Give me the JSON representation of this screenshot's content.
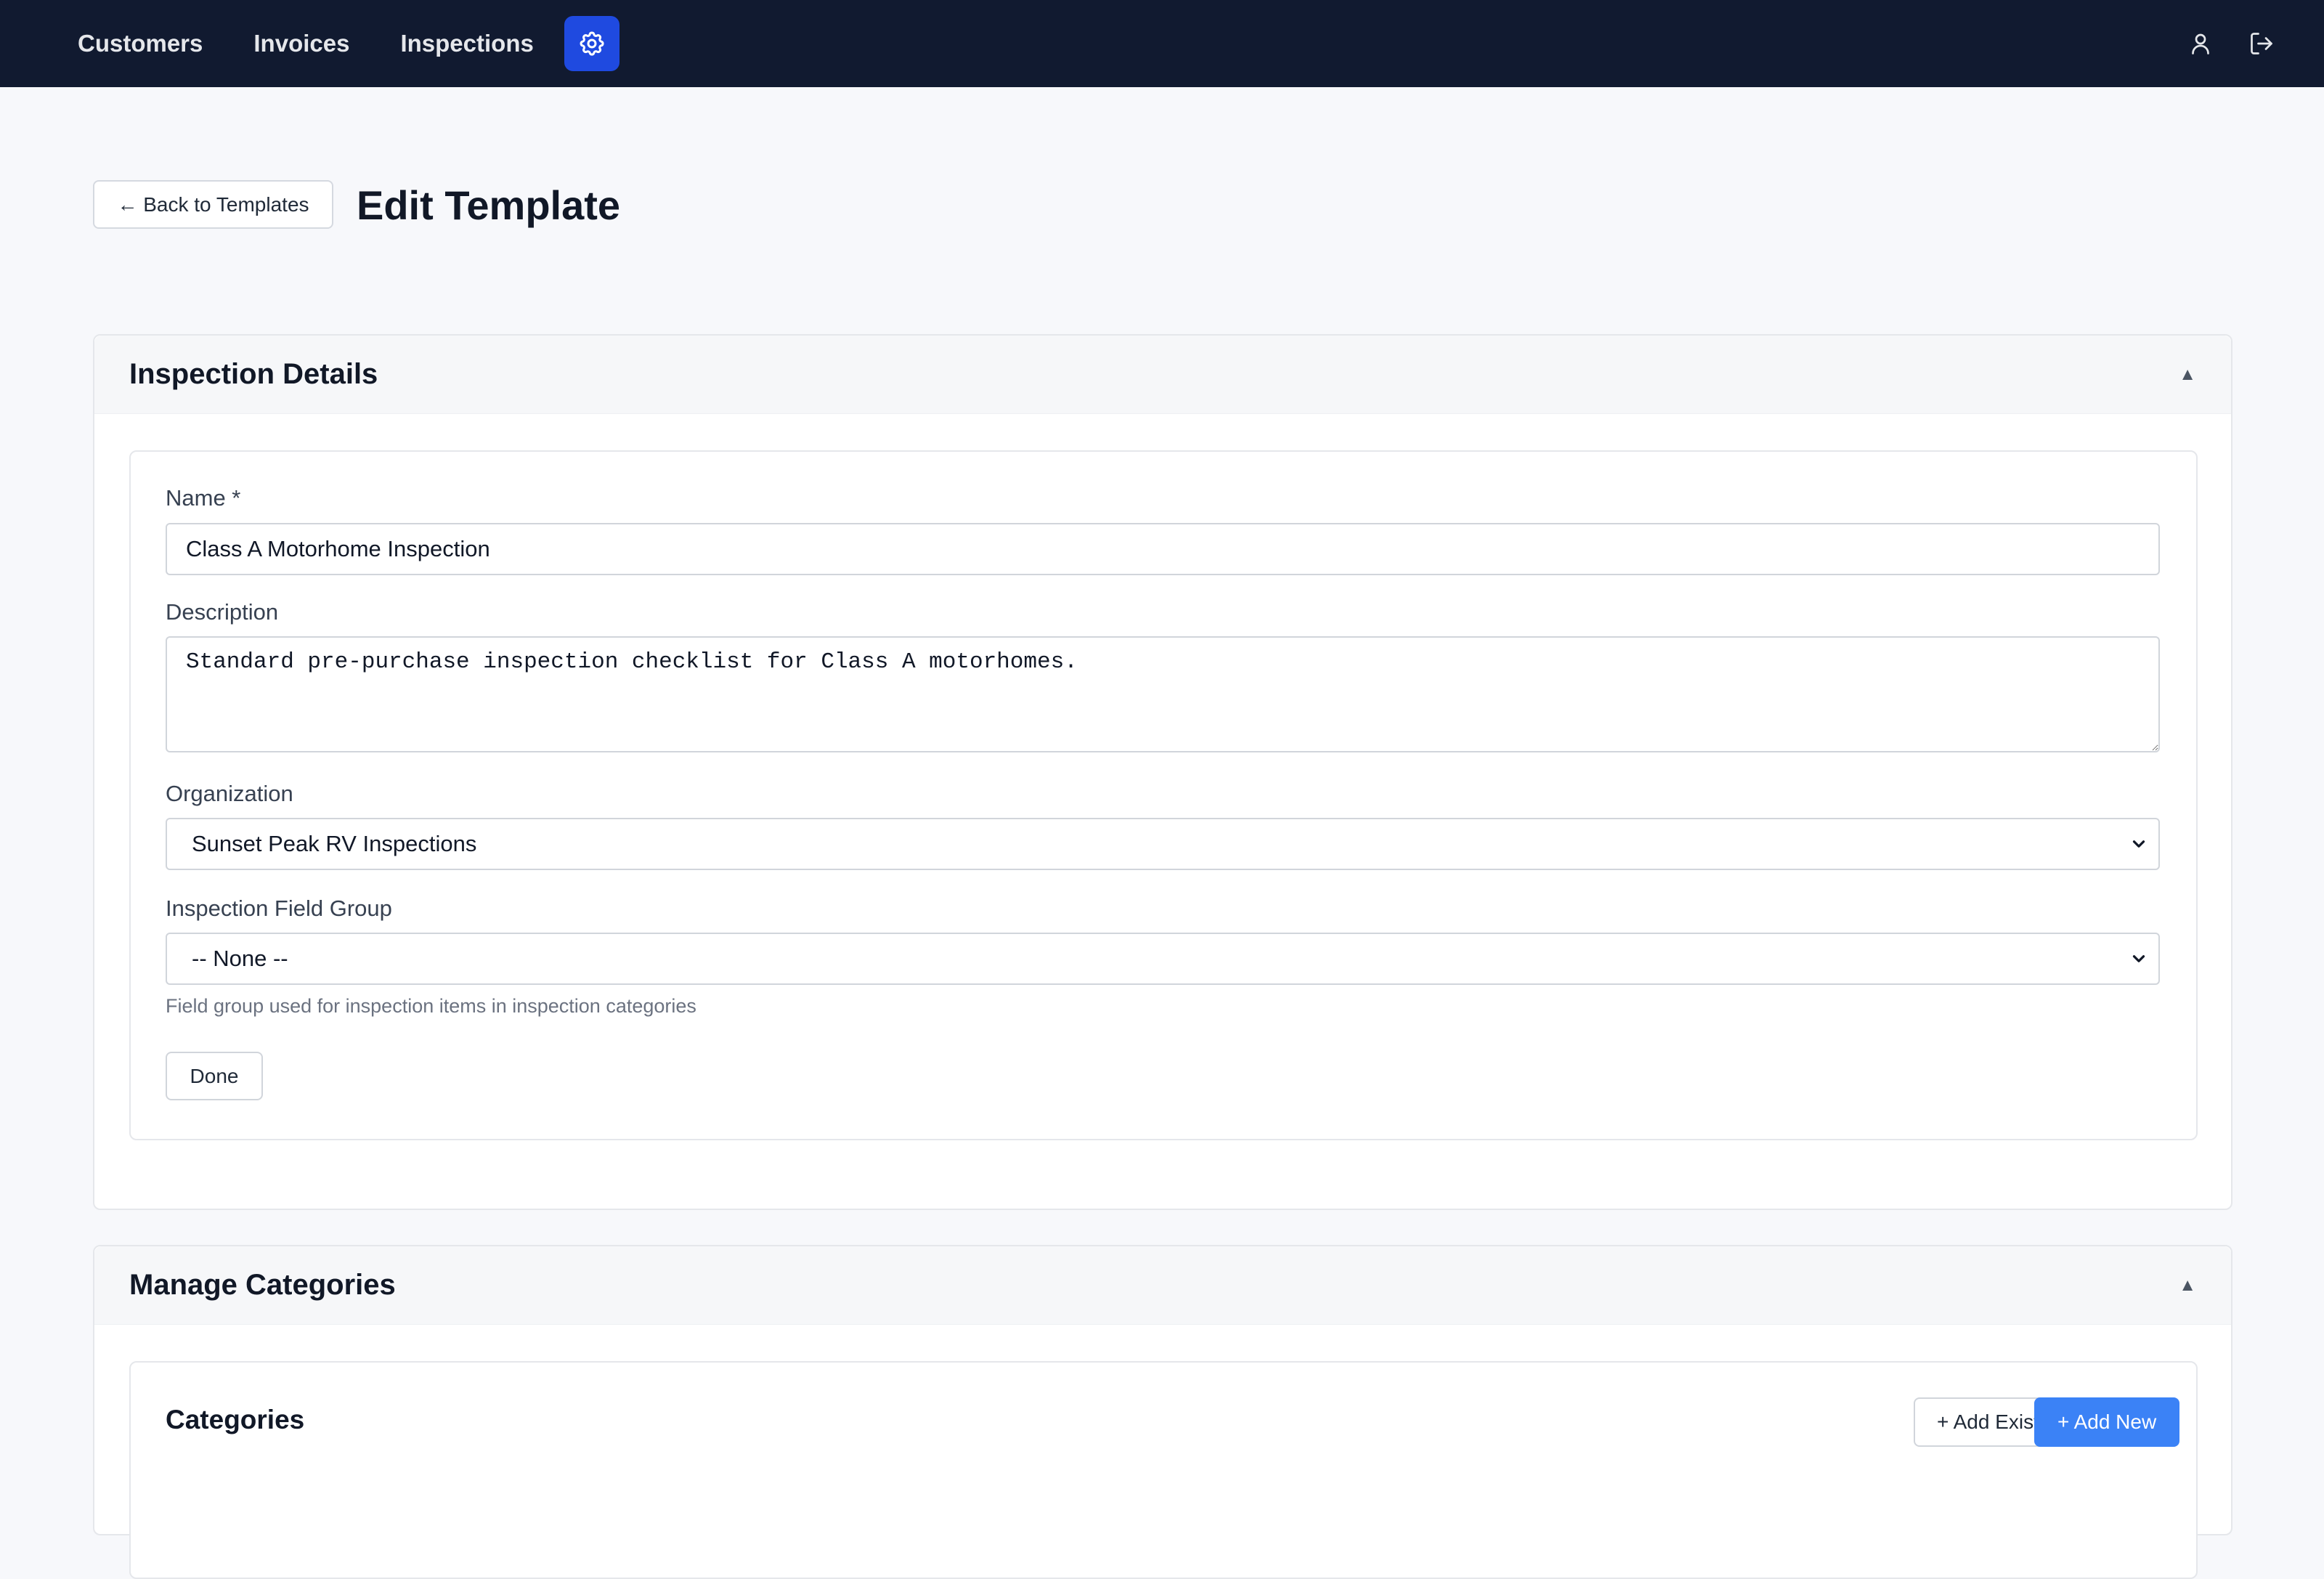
{
  "nav": {
    "links": [
      "Customers",
      "Invoices",
      "Inspections"
    ],
    "settings_icon": "gear-icon",
    "user_icon": "user-icon",
    "logout_icon": "logout-icon",
    "bar_color": "#111a30",
    "accent": "#1f4ae0"
  },
  "header": {
    "back_label": "← Back to Templates",
    "title": "Edit Template"
  },
  "details": {
    "title": "Inspection Details",
    "caret": "▲",
    "name_label": "Name *",
    "name_value": "Class A Motorhome Inspection",
    "description_label": "Description",
    "description_value": "Standard pre-purchase inspection checklist for Class A motorhomes.",
    "organization_label": "Organization",
    "organization_value": "Sunset Peak RV Inspections",
    "field_group_label": "Inspection Field Group",
    "field_group_value": "-- None --",
    "field_group_help": "Field group used for inspection items in inspection categories",
    "done_label": "Done"
  },
  "categories": {
    "title": "Manage Categories",
    "caret": "▲",
    "section_title": "Categories",
    "add_existing_label": "+ Add Existing",
    "add_new_label": "+ Add New",
    "primary_color": "#3b82f6"
  }
}
